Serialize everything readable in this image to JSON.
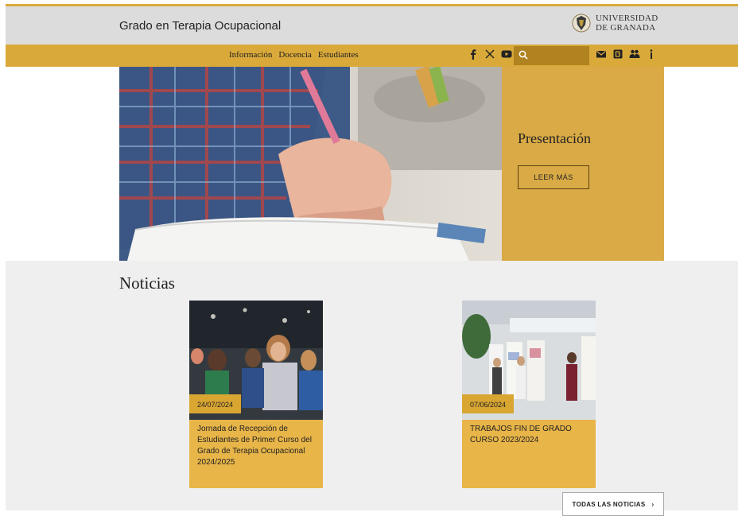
{
  "header": {
    "site_title": "Grado en Terapia Ocupacional",
    "university_line1": "UNIVERSIDAD",
    "university_line2": "DE GRANADA"
  },
  "nav": {
    "items": [
      "Información",
      "Docencia",
      "Estudiantes"
    ],
    "social_icons": [
      "facebook-icon",
      "x-icon",
      "youtube-icon"
    ],
    "search_placeholder": "",
    "tool_icons": [
      "mail-icon",
      "blog-icon",
      "people-icon",
      "info-icon"
    ]
  },
  "hero": {
    "title": "Presentación",
    "button": "LEER MÁS"
  },
  "news": {
    "title": "Noticias",
    "items": [
      {
        "date": "24/07/2024",
        "text": "Jornada de Recepción de Estudiantes de Primer Curso del Grado de Terapia Ocupacional 2024/2025"
      },
      {
        "date": "07/06/2024",
        "text": "TRABAJOS FIN DE GRADO CURSO 2023/2024"
      }
    ],
    "all_button": "TODAS LAS NOTICIAS"
  },
  "colors": {
    "accent": "#d9a93a",
    "accent_dark": "#b08320",
    "header_bg": "#dcdcdc",
    "news_bg": "#efefef"
  }
}
